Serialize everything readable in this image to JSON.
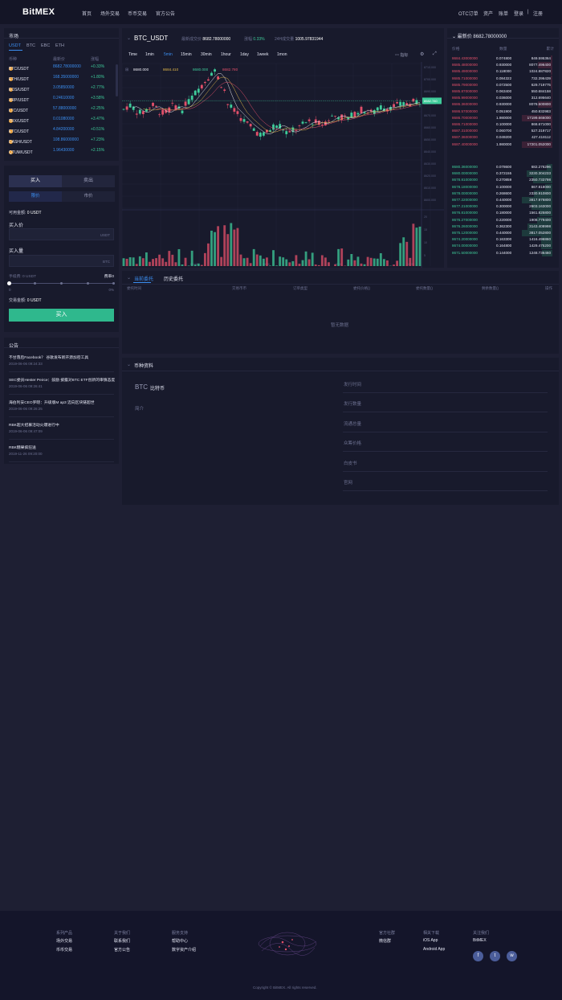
{
  "header": {
    "logo": "BitMEX",
    "nav": [
      "首页",
      "场外交易",
      "币币交易",
      "官方公告"
    ],
    "right": [
      "OTC订单",
      "资产",
      "账单",
      "登录",
      "|",
      "注册"
    ]
  },
  "market": {
    "title": "市场",
    "tabs": [
      "USDT",
      "BTC",
      "EBC",
      "ETH"
    ],
    "columns": [
      "币种",
      "最新价",
      "涨幅"
    ],
    "rows": [
      {
        "pair": "BTC/USDT",
        "price": "8682.78000000",
        "change": "+0.33%"
      },
      {
        "pair": "ETH/USDT",
        "price": "168.35000000",
        "change": "+1.80%"
      },
      {
        "pair": "EOS/USDT",
        "price": "3.05850000",
        "change": "+2.77%"
      },
      {
        "pair": "XRP/USDT",
        "price": "0.24610000",
        "change": "+3.58%"
      },
      {
        "pair": "LTC/USDT",
        "price": "57.88000000",
        "change": "+2.25%"
      },
      {
        "pair": "TRX/USDT",
        "price": "0.01080000",
        "change": "+3.47%"
      },
      {
        "pair": "ETC/USDT",
        "price": "4.84200000",
        "change": "+0.51%"
      },
      {
        "pair": "DASH/USDT",
        "price": "108.86000000",
        "change": "+7.23%"
      },
      {
        "pair": "QTUM/USDT",
        "price": "1.96430000",
        "change": "+2.15%"
      }
    ]
  },
  "trade": {
    "buy_tab": "买入",
    "sell_tab": "卖出",
    "limit_tab": "限价",
    "market_tab": "市价",
    "available_label": "可用金额:",
    "available_value": "0 USDT",
    "price_label": "买入价",
    "price_unit": "USDT",
    "amount_label": "买入量",
    "amount_unit": "BTC",
    "fee_label": "手续费: 0 USDT",
    "rate_label": "费率0",
    "slider_min": "0",
    "slider_max": "0%",
    "total_label": "交易金额:",
    "total_value": "0 USDT",
    "submit": "买入"
  },
  "notice": {
    "title": "公告",
    "items": [
      {
        "title": "不甘落后Facebook？ 谷歌发布新开源加密工具",
        "date": "2019-06-06 09:24:33"
      },
      {
        "title": "SEC委员Hester Peirce：鼓励 披露对BTC ETF创新的审慎态度",
        "date": "2019-06-06 09:26:41"
      },
      {
        "title": "海伯利安CEO罗晓：升级版M ap3 迈向区块链超世",
        "date": "2019-06-06 09:26:25"
      },
      {
        "title": "RBK超大招募活动火爆进行中",
        "date": "2019-06-06 09:47:09"
      },
      {
        "title": "RBK糖果疯狂送",
        "date": "2019-11-26 09:20:00"
      }
    ]
  },
  "chart_header": {
    "pair": "BTC_USDT",
    "last_label": "最新成交价",
    "last_value": "8682.78000000",
    "change_label": "涨幅",
    "change_value": "0.33%",
    "vol_label": "24H成交量",
    "vol_value": "1005.97831944"
  },
  "chart_toolbar": {
    "intervals": [
      "Time",
      "1min",
      "5min",
      "15min",
      "30min",
      "1hour",
      "1day",
      "1week",
      "1mon"
    ],
    "active": "5min",
    "indicator": "指标"
  },
  "ma_values": [
    "8680.000",
    "8684.410",
    "8680.000",
    "8682.780"
  ],
  "price_axis": [
    "8710.000",
    "8700.000",
    "8690.000",
    "8680.000",
    "8670.000",
    "8660.000",
    "8650.000",
    "8640.000",
    "8630.000",
    "8620.000",
    "8610.000",
    "8600.000"
  ],
  "price_tag": "8682.780",
  "time_axis": [
    "09:00",
    "09:30",
    "10:00",
    "10:30",
    "11:00"
  ],
  "volume_axis": [
    "20",
    "15",
    "10",
    "5"
  ],
  "chart_data": {
    "type": "candlestick",
    "last_price": 8682.78,
    "ohlc_note": "approximate 5min candles",
    "colors": {
      "up": "#3ecb9a",
      "down": "#e2506a",
      "ma1": "#e8e8f0",
      "ma2": "#e2b84a",
      "ma3": "#e2506a"
    }
  },
  "orderbook": {
    "title": "最新价",
    "title_value": "8682.78000000",
    "columns": [
      "价格",
      "数量",
      "累计"
    ],
    "asks": [
      {
        "price": "8684.43000000",
        "qty": "0.074800",
        "total": "849.595364"
      },
      {
        "price": "8685.48000000",
        "qty": "0.930000",
        "total": "8077.496400"
      },
      {
        "price": "8685.49000000",
        "qty": "0.118000",
        "total": "1024.887820"
      },
      {
        "price": "8685.71000000",
        "qty": "0.084322",
        "total": "732.396439"
      },
      {
        "price": "8685.79000000",
        "qty": "0.072500",
        "total": "629.719775"
      },
      {
        "price": "8685.87000000",
        "qty": "0.063400",
        "total": "550.684158"
      },
      {
        "price": "8685.99000000",
        "qty": "0.036000",
        "total": "312.695640"
      },
      {
        "price": "8686.36000000",
        "qty": "0.930000",
        "total": "8078.500800"
      },
      {
        "price": "8686.57000000",
        "qty": "0.051900",
        "total": "450.832983"
      },
      {
        "price": "8686.70000000",
        "qty": "1.980000",
        "total": "17199.666000"
      },
      {
        "price": "8686.71000000",
        "qty": "0.100000",
        "total": "868.671000"
      },
      {
        "price": "8687.31000000",
        "qty": "0.060700",
        "total": "527.319717"
      },
      {
        "price": "8687.36000000",
        "qty": "0.049200",
        "total": "427.418112"
      },
      {
        "price": "8687.40000000",
        "qty": "1.980000",
        "total": "17201.052000"
      }
    ],
    "asks_depth": [
      0.05,
      0.47,
      0.06,
      0.04,
      0.04,
      0.03,
      0.02,
      0.47,
      0.03,
      1.0,
      0.05,
      0.03,
      0.02,
      1.0
    ],
    "bids": [
      {
        "price": "8680.36000000",
        "qty": "0.078600",
        "total": "682.276296"
      },
      {
        "price": "8680.00000000",
        "qty": "0.372155",
        "total": "3230.304233"
      },
      {
        "price": "8678.81000000",
        "qty": "0.270859",
        "total": "2350.733798"
      },
      {
        "price": "8678.18000000",
        "qty": "0.100000",
        "total": "867.818000"
      },
      {
        "price": "8678.00000000",
        "qty": "0.268600",
        "total": "2330.910800"
      },
      {
        "price": "8677.22000000",
        "qty": "0.440000",
        "total": "3817.976800"
      },
      {
        "price": "8677.21000000",
        "qty": "0.300000",
        "total": "2603.163000"
      },
      {
        "price": "8676.81000000",
        "qty": "0.180000",
        "total": "1561.825800"
      },
      {
        "price": "8676.27000000",
        "qty": "0.220000",
        "total": "1908.779400"
      },
      {
        "price": "8676.26000000",
        "qty": "0.362300",
        "total": "3143.408998"
      },
      {
        "price": "8675.12000000",
        "qty": "0.440000",
        "total": "3817.052800"
      },
      {
        "price": "8674.20000000",
        "qty": "0.163300",
        "total": "1416.496860"
      },
      {
        "price": "8674.00000000",
        "qty": "0.164800",
        "total": "1429.475200"
      },
      {
        "price": "8671.50000000",
        "qty": "0.144000",
        "total": "1248.736460"
      }
    ],
    "bids_depth": [
      0.18,
      0.85,
      0.62,
      0.23,
      0.61,
      1.0,
      0.68,
      0.41,
      0.5,
      0.82,
      1.0,
      0.37,
      0.37,
      0.33
    ]
  },
  "orders": {
    "tabs": [
      "当前委托",
      "历史委托"
    ],
    "columns": [
      "委托时间",
      "交易币币",
      "订单类型",
      "委托价格()",
      "委托数量()",
      "剩余数量()",
      "操作"
    ],
    "empty": "暂无数据"
  },
  "coin_info": {
    "title": "币种资料",
    "coin": "BTC",
    "coin_name": "比特币",
    "intro_label": "简介",
    "fields": [
      "发行时间",
      "发行数量",
      "流通总量",
      "众筹价格",
      "白皮书",
      "官网"
    ]
  },
  "footer": {
    "cols": [
      {
        "head": "系列产品",
        "items": [
          "场外交易",
          "币币交易"
        ]
      },
      {
        "head": "关于我们",
        "items": [
          "联系我们",
          "官方公告"
        ]
      },
      {
        "head": "服务支持",
        "items": [
          "帮助中心",
          "数字资产介绍"
        ]
      },
      {
        "head": "官方社群",
        "items": [
          "微信群"
        ]
      },
      {
        "head": "相关下载",
        "items": [
          "iOS App",
          "Android App"
        ]
      },
      {
        "head": "关注我们",
        "items": [
          "BitMEX"
        ]
      }
    ],
    "social": [
      "f",
      "t",
      "w"
    ],
    "copyright": "Copyright © BitMEX. All rights reserved."
  }
}
